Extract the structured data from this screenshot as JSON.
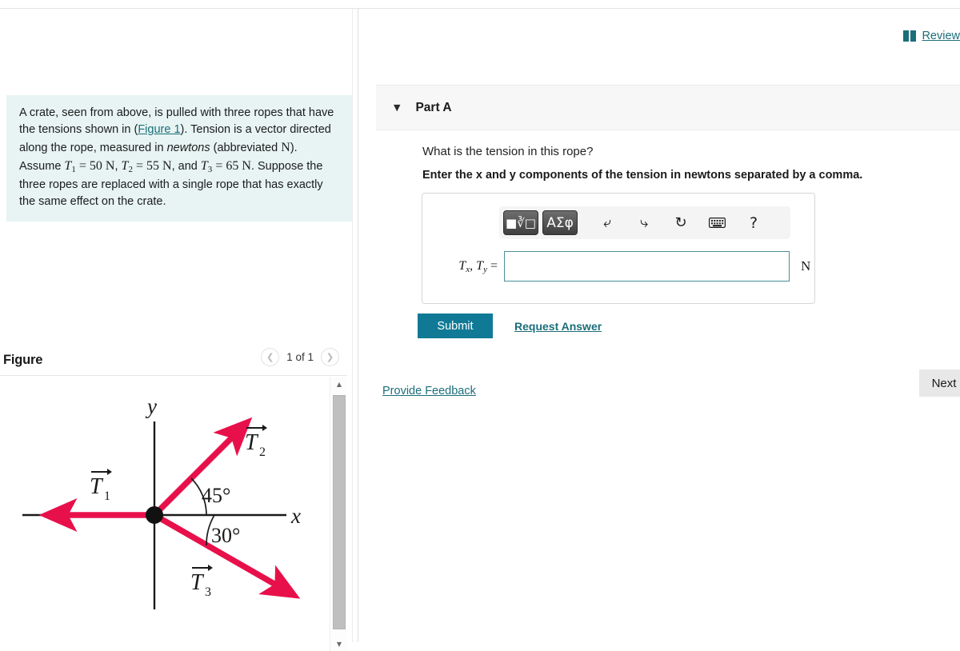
{
  "left": {
    "problem": {
      "text_parts": [
        "A crate, seen from above, is pulled with three ropes that have the tensions shown in (",
        "Figure 1",
        "). Tension is a vector directed along the rope, measured in ",
        "newtons",
        " (abbreviated ",
        "N",
        "). Assume ",
        "T",
        "1",
        " = 50 N, ",
        "T",
        "2",
        " = 55 N, and ",
        "T",
        "3",
        " = 65 N. Suppose the three ropes are replaced with a single rope that has exactly the same effect on the crate."
      ],
      "figure_link_label": "Figure 1",
      "tensions": [
        {
          "symbol": "T1",
          "value": 50,
          "unit": "N"
        },
        {
          "symbol": "T2",
          "value": 55,
          "unit": "N"
        },
        {
          "symbol": "T3",
          "value": 65,
          "unit": "N"
        }
      ],
      "background_color": "#e7f4f3"
    },
    "figure_section": {
      "title": "Figure",
      "pager": {
        "prev_icon": "chevron-left-icon",
        "next_icon": "chevron-right-icon",
        "label": "1 of 1",
        "current": 1,
        "total": 1
      },
      "scrollbar": {
        "up_icon": "triangle-up-icon",
        "down_icon": "triangle-down-icon"
      }
    },
    "diagram": {
      "axis_labels": {
        "x": "x",
        "y": "y"
      },
      "vectors": [
        {
          "name": "T1",
          "label": "T⃗1",
          "direction_deg": 180,
          "color": "#e8104a"
        },
        {
          "name": "T2",
          "label": "T⃗2",
          "direction_deg": 45,
          "color": "#e8104a"
        },
        {
          "name": "T3",
          "label": "T⃗3",
          "direction_deg": -30,
          "color": "#e8104a"
        }
      ],
      "angle_labels": [
        "45°",
        "30°"
      ],
      "origin_dot_color": "#111111",
      "vector_color": "#e8104a"
    }
  },
  "right": {
    "review": {
      "icon": "book-icon",
      "label": "Review",
      "color": "#1c6e7a"
    },
    "part": {
      "caret_icon": "caret-down-icon",
      "label": "Part A",
      "header_bg": "#f7f7f7"
    },
    "question": "What is the tension in this rope?",
    "instruction": "Enter the x and y components of the tension in newtons separated by a comma.",
    "answer_widget": {
      "toolbar": [
        {
          "name": "math-template-button",
          "label": "■√□",
          "kind": "dark-button"
        },
        {
          "name": "greek-symbols-button",
          "label": "ΑΣφ",
          "kind": "dark-button"
        },
        {
          "name": "undo-icon",
          "label": "↰",
          "kind": "icon"
        },
        {
          "name": "redo-icon",
          "label": "↱",
          "kind": "icon"
        },
        {
          "name": "reset-icon",
          "label": "↻",
          "kind": "icon"
        },
        {
          "name": "keyboard-icon",
          "label": "⌨",
          "kind": "icon"
        },
        {
          "name": "help-icon",
          "label": "?",
          "kind": "icon"
        }
      ],
      "field_label": "Tx, Ty =",
      "field_label_parts": {
        "t": "T",
        "xsub": "x",
        "comma": ", ",
        "t2": "T",
        "ysub": "y",
        "eq": " ="
      },
      "value": "",
      "placeholder": "",
      "unit": "N",
      "border_color": "#4a8f96"
    },
    "submit_label": "Submit",
    "submit_color": "#107a96",
    "request_answer_label": "Request Answer",
    "provide_feedback_label": "Provide Feedback",
    "next_label": "Next"
  }
}
